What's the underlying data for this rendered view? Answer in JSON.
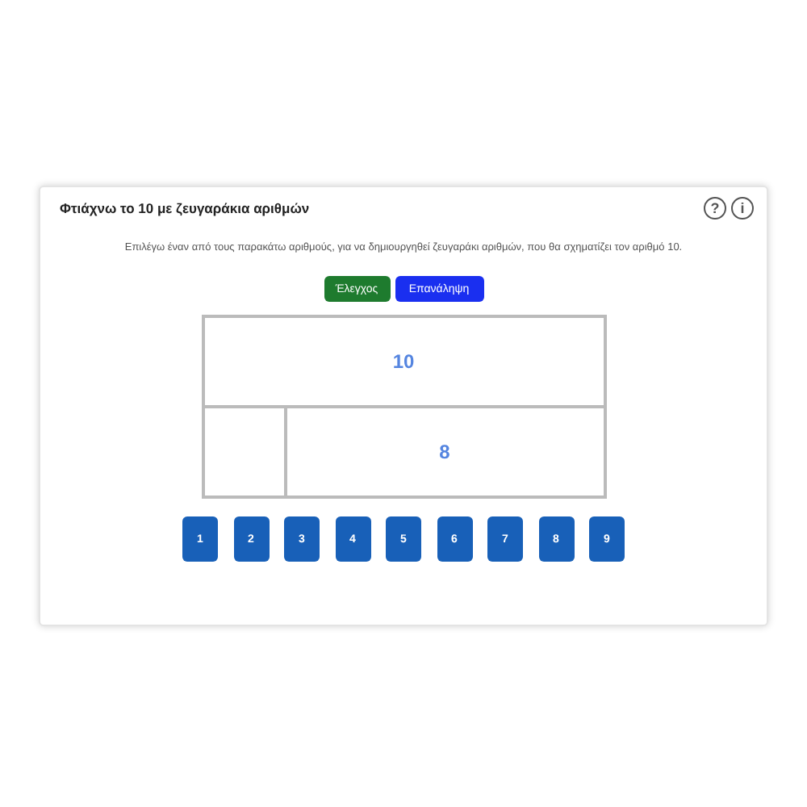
{
  "card": {
    "title": "Φτιάχνω το 10 με ζευγαράκια αριθμών",
    "help_icon": "?",
    "info_icon": "i"
  },
  "instruction": "Επιλέγω έναν από τους παρακάτω αριθμούς, για να δημιουργηθεί ζευγαράκι αριθμών, που θα σχηματίζει τον αριθμό 10.",
  "buttons": [
    {
      "label": "Έλεγχος",
      "kind": "check"
    },
    {
      "label": "Επανάληψη",
      "kind": "repeat"
    }
  ],
  "bar_model": {
    "total": "10",
    "part_2": "8"
  },
  "number_choices": [
    "1",
    "2",
    "3",
    "4",
    "5",
    "6",
    "7",
    "8",
    "9"
  ]
}
